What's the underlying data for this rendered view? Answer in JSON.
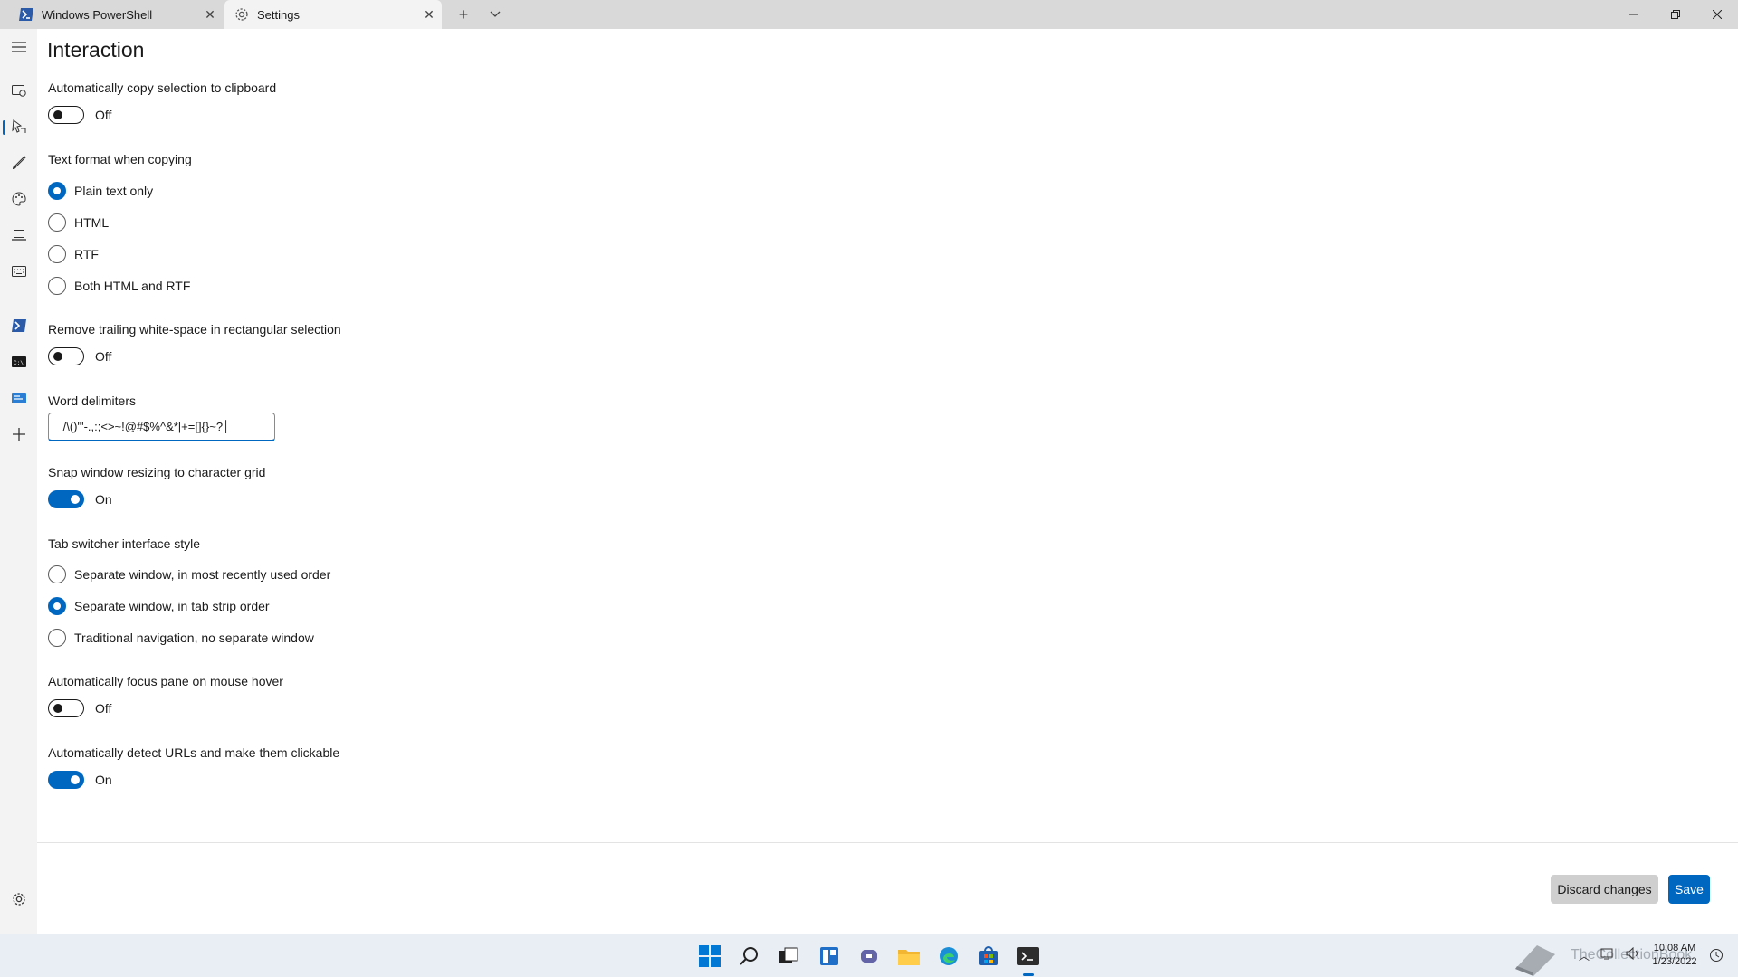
{
  "titlebar": {
    "tabs": [
      {
        "label": "Windows PowerShell",
        "icon": "powershell-icon"
      },
      {
        "label": "Settings",
        "icon": "gear-icon"
      }
    ]
  },
  "nav": {
    "items": [
      {
        "icon": "hamburger-menu-icon"
      },
      {
        "icon": "startup-icon"
      },
      {
        "icon": "interaction-icon",
        "selected": true
      },
      {
        "icon": "appearance-brush-icon"
      },
      {
        "icon": "color-schemes-icon"
      },
      {
        "icon": "rendering-laptop-icon"
      },
      {
        "icon": "actions-keyboard-icon"
      },
      {
        "icon": "powershell-profile-icon"
      },
      {
        "icon": "command-prompt-profile-icon"
      },
      {
        "icon": "azure-cloud-shell-profile-icon"
      },
      {
        "icon": "add-profile-icon"
      },
      {
        "icon": "open-json-settings-icon"
      }
    ]
  },
  "page": {
    "title": "Interaction",
    "copy_on_select": {
      "label": "Automatically copy selection to clipboard",
      "state": "Off",
      "on": false
    },
    "copy_format": {
      "label": "Text format when copying",
      "options": [
        "Plain text only",
        "HTML",
        "RTF",
        "Both HTML and RTF"
      ],
      "selected": 0
    },
    "trim_block": {
      "label": "Remove trailing white-space in rectangular selection",
      "state": "Off",
      "on": false
    },
    "word_delimiters": {
      "label": "Word delimiters",
      "value": " /\\()\"'-.,:;<>~!@#$%^&*|+=[]{}~?│"
    },
    "snap_resize": {
      "label": "Snap window resizing to character grid",
      "state": "On",
      "on": true
    },
    "tab_switcher": {
      "label": "Tab switcher interface style",
      "options": [
        "Separate window, in most recently used order",
        "Separate window, in tab strip order",
        "Traditional navigation, no separate window"
      ],
      "selected": 1
    },
    "focus_follow_mouse": {
      "label": "Automatically focus pane on mouse hover",
      "state": "Off",
      "on": false
    },
    "detect_urls": {
      "label": "Automatically detect URLs and make them clickable",
      "state": "On",
      "on": true
    }
  },
  "footer": {
    "discard_label": "Discard changes",
    "save_label": "Save"
  },
  "taskbar": {
    "watermark": "TheCollectionBook",
    "clock_time": "10:08 AM",
    "clock_date": "1/23/2022"
  },
  "colors": {
    "accent": "#0067c0",
    "titlebar": "#d9d9d9",
    "nav_bg": "#f3f3f3",
    "taskbar_bg": "#e9eef5"
  }
}
